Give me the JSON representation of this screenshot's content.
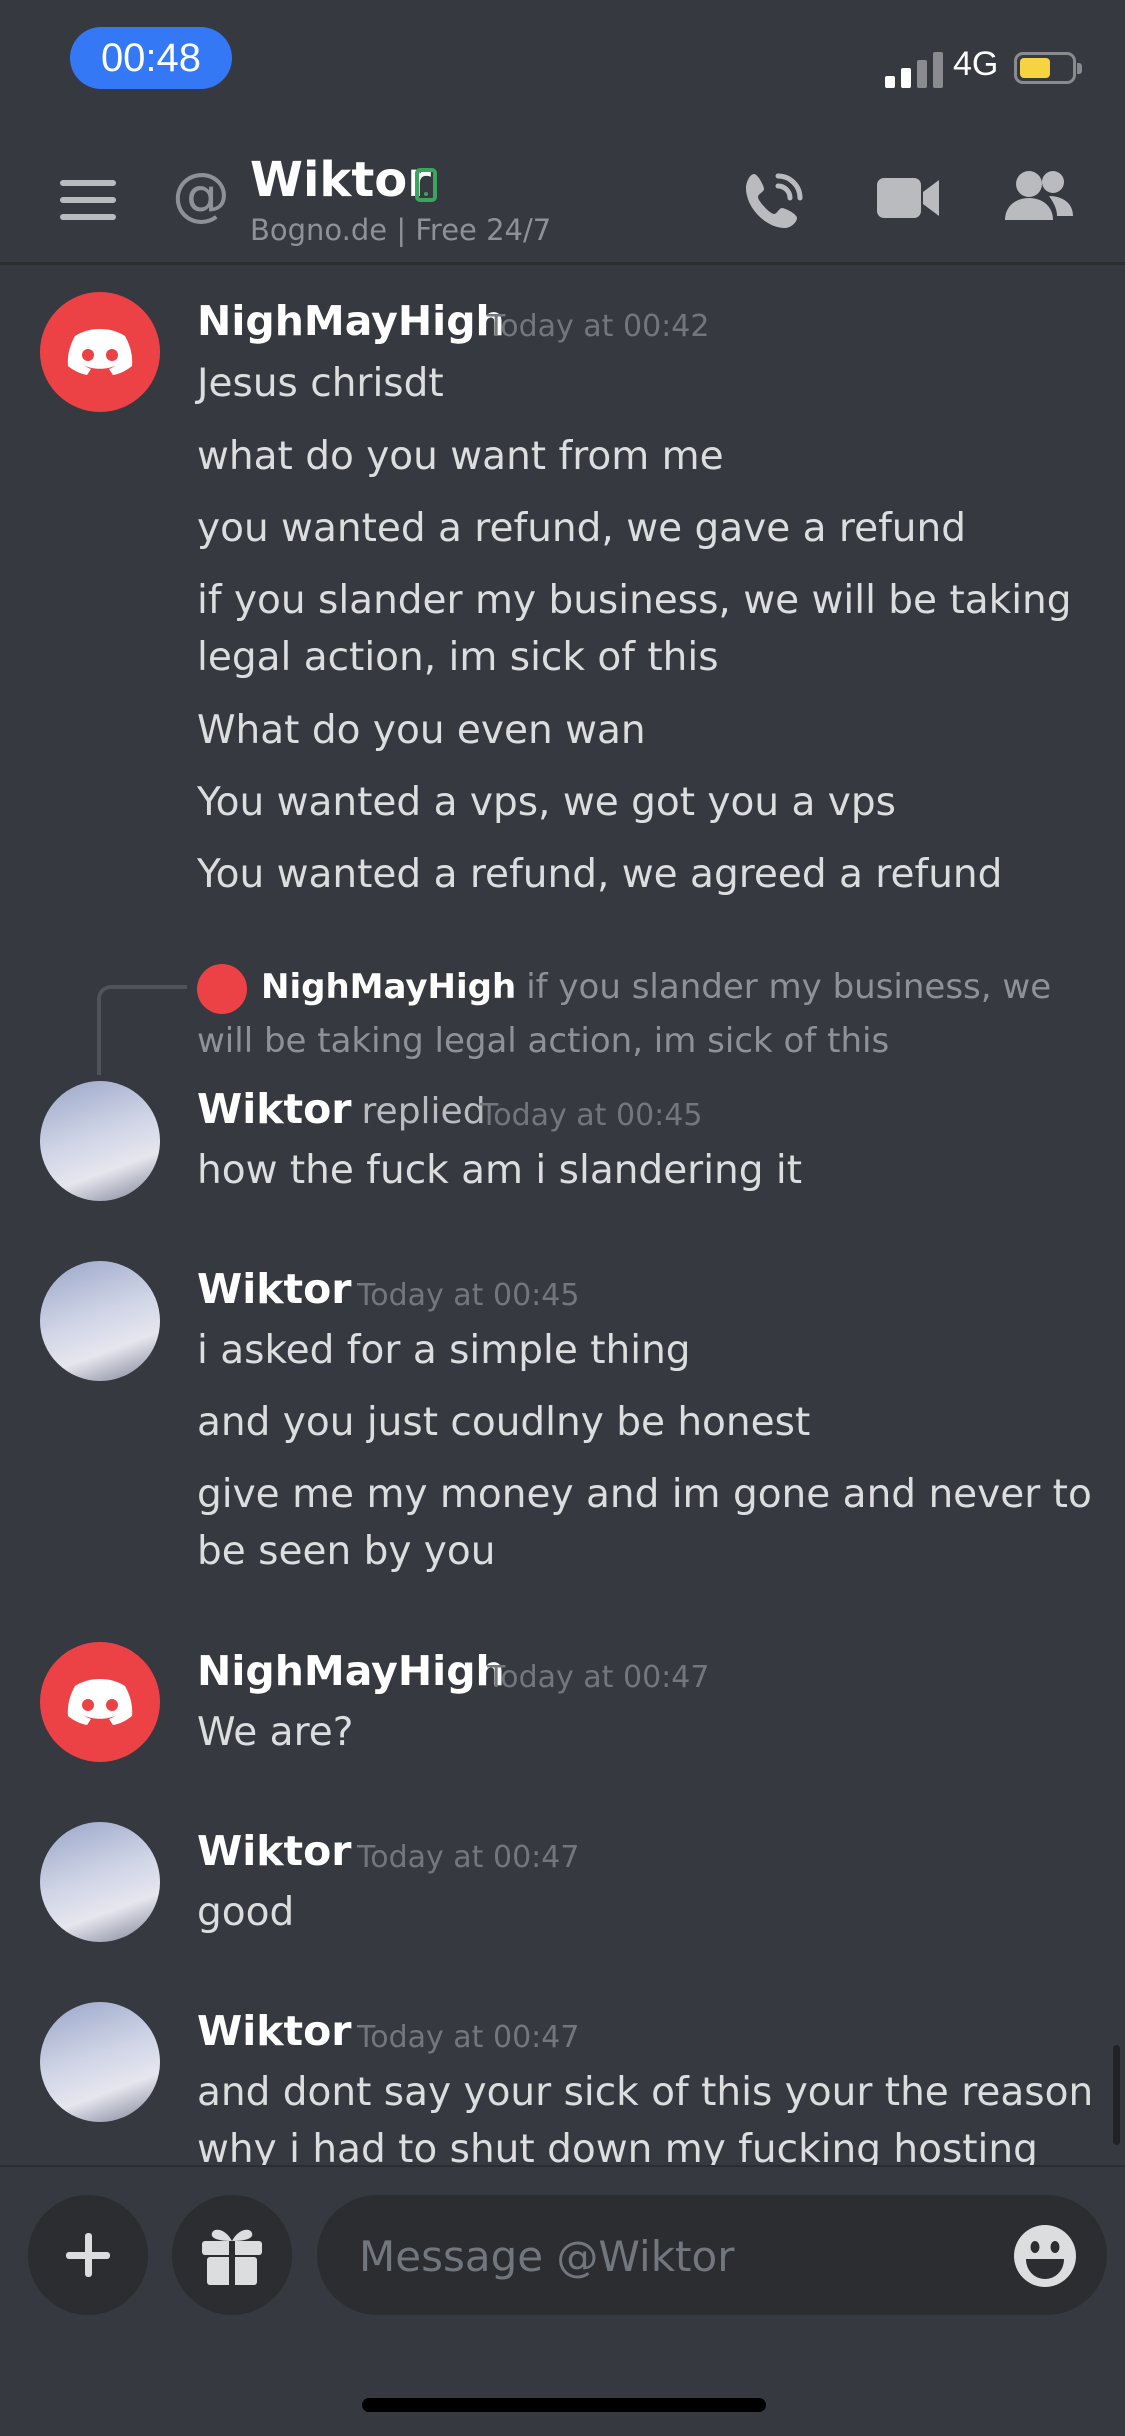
{
  "status_bar": {
    "time": "00:48",
    "network": "4G"
  },
  "header": {
    "title": "Wiktor",
    "subtitle": "Bogno.de  | Free 24/7",
    "icons": [
      "hamburger-menu-icon",
      "at-icon",
      "mobile-status-icon",
      "call-icon",
      "video-icon",
      "members-icon"
    ]
  },
  "messages": [
    {
      "author": "NighMayHigh",
      "time": "Today at 00:42",
      "lines": [
        "Jesus chrisdt",
        "what do you want from me",
        "you wanted a refund, we gave a refund",
        "if you slander my business, we will be taking legal action, im sick of this",
        "What do you even wan",
        "You wanted a vps, we got you a vps",
        "You wanted a refund, we agreed a refund"
      ]
    },
    {
      "reply_to": {
        "author": "NighMayHigh",
        "text": "if you slander my business, we will be taking legal action, im sick of this"
      },
      "author": "Wiktor",
      "replied": "replied",
      "time": "Today at 00:45",
      "lines": [
        "how the fuck am i slandering it"
      ]
    },
    {
      "author": "Wiktor",
      "time": "Today at 00:45",
      "lines": [
        "i asked for a simple thing",
        "and you just coudlny be honest",
        "give me my money and im gone and never to be seen by you"
      ]
    },
    {
      "author": "NighMayHigh",
      "time": "Today at 00:47",
      "lines": [
        "We are?"
      ]
    },
    {
      "author": "Wiktor",
      "time": "Today at 00:47",
      "lines": [
        "good"
      ]
    },
    {
      "author": "Wiktor",
      "time": "Today at 00:47",
      "lines": [
        "and dont say your sick of this your the reason why i had to shut down my fucking hosting"
      ]
    }
  ],
  "composer": {
    "placeholder": "Message @Wiktor"
  },
  "colors": {
    "background": "#36393f",
    "discord_red": "#ed4245",
    "online_green": "#3ba55d",
    "time_pill": "#3478f6"
  }
}
